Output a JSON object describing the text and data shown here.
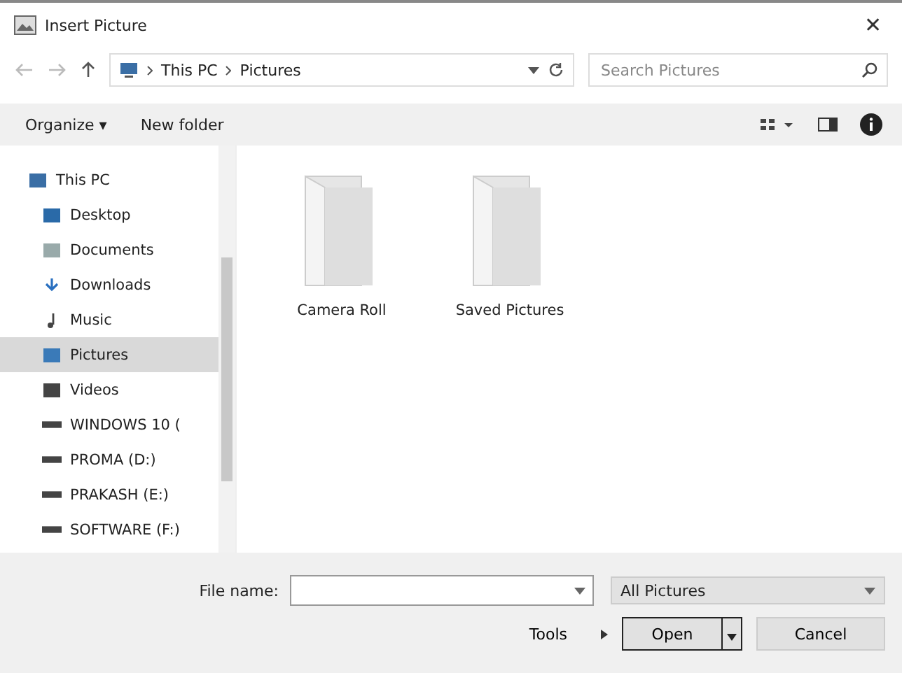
{
  "window": {
    "title": "Insert Picture",
    "close": "✕"
  },
  "address": {
    "crumbs": [
      "This PC",
      "Pictures"
    ],
    "search_placeholder": "Search Pictures"
  },
  "toolbar": {
    "organize": "Organize ▾",
    "new_folder": "New folder"
  },
  "sidebar": {
    "items": [
      {
        "label": "This PC",
        "kind": "pc",
        "selected": false,
        "children": [
          {
            "label": "Desktop",
            "kind": "desktop",
            "selected": false
          },
          {
            "label": "Documents",
            "kind": "documents",
            "selected": false
          },
          {
            "label": "Downloads",
            "kind": "downloads",
            "selected": false
          },
          {
            "label": "Music",
            "kind": "music",
            "selected": false
          },
          {
            "label": "Pictures",
            "kind": "pictures",
            "selected": true
          },
          {
            "label": "Videos",
            "kind": "videos",
            "selected": false
          },
          {
            "label": "WINDOWS 10 (",
            "kind": "drive",
            "selected": false
          },
          {
            "label": "PROMA (D:)",
            "kind": "drive",
            "selected": false
          },
          {
            "label": "PRAKASH (E:)",
            "kind": "drive",
            "selected": false
          },
          {
            "label": "SOFTWARE (F:)",
            "kind": "drive",
            "selected": false
          }
        ]
      }
    ]
  },
  "folders": [
    {
      "label": "Camera Roll"
    },
    {
      "label": "Saved Pictures"
    }
  ],
  "footer": {
    "file_name_label": "File name:",
    "file_type": "All Pictures",
    "tools": "Tools",
    "open": "Open",
    "cancel": "Cancel"
  }
}
